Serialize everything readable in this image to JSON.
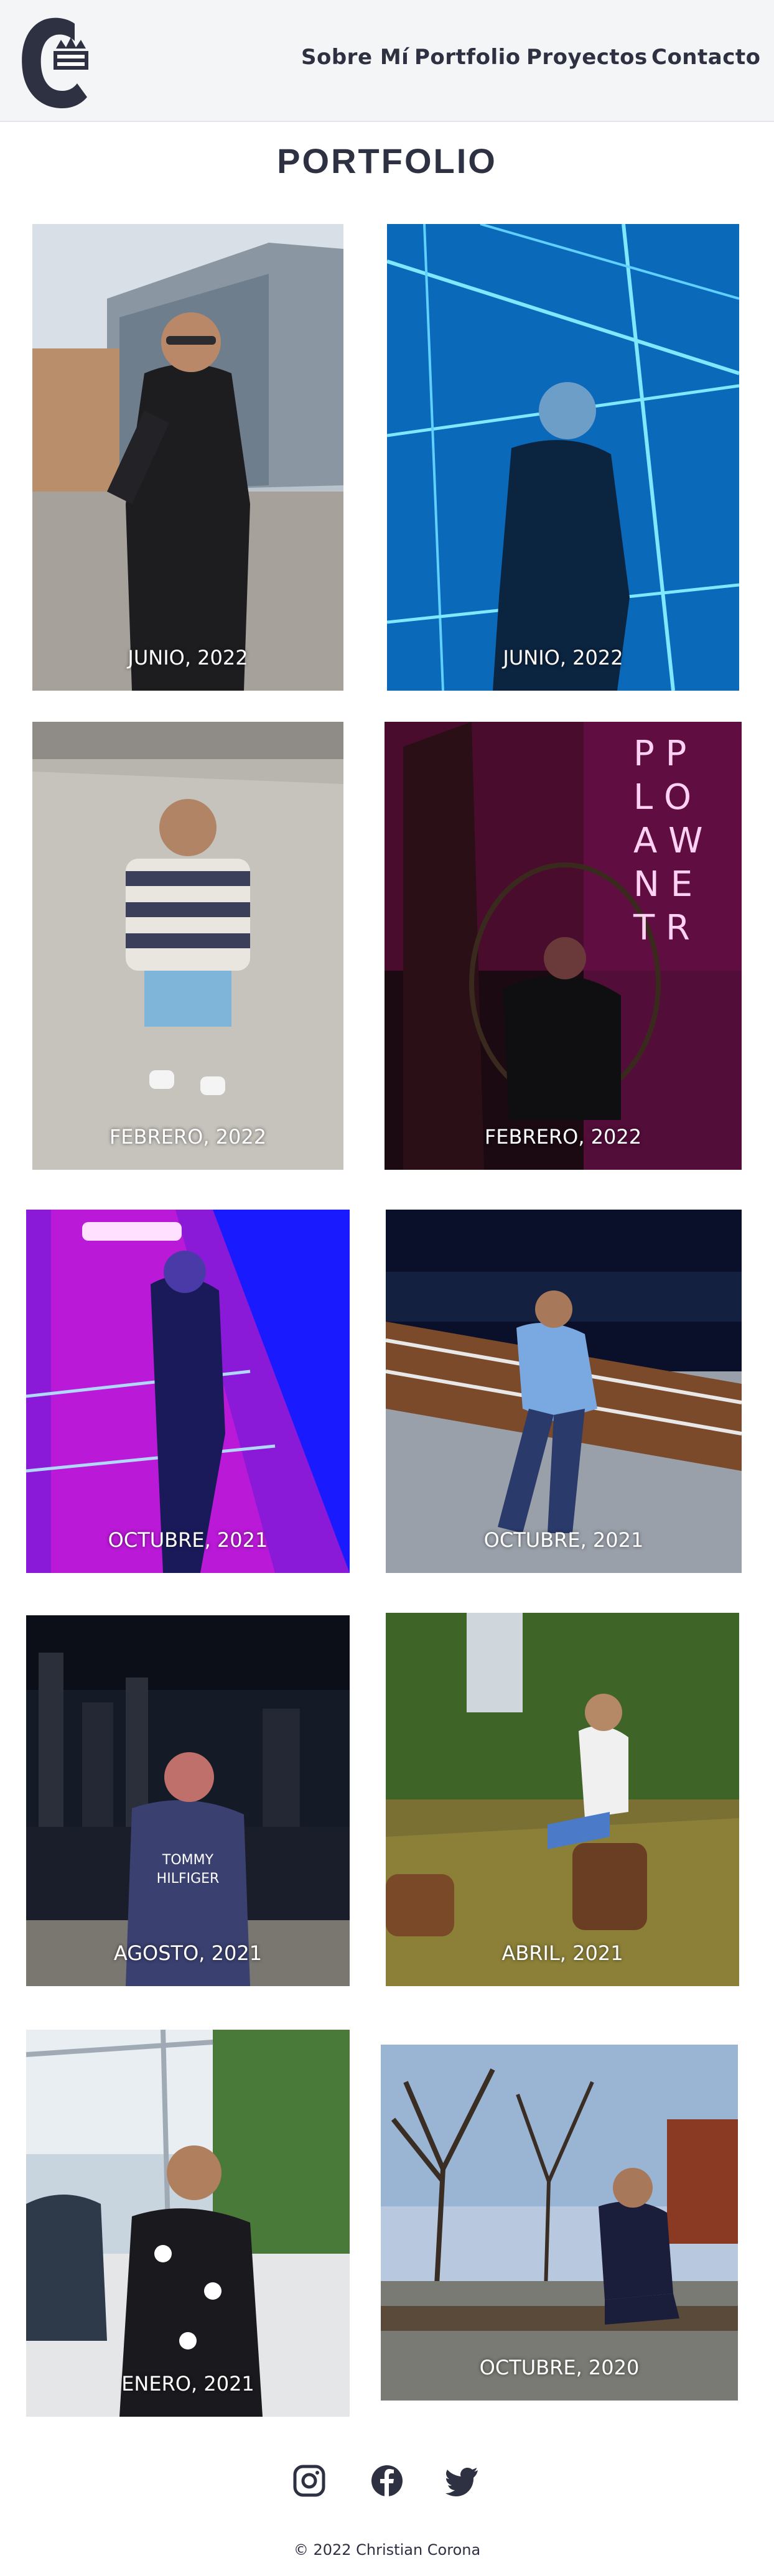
{
  "nav": {
    "items": [
      {
        "label": "Sobre Mí"
      },
      {
        "label": "Portfolio"
      },
      {
        "label": "Proyectos"
      },
      {
        "label": "Contacto"
      }
    ]
  },
  "page": {
    "title": "PORTFOLIO"
  },
  "gallery": [
    {
      "caption": "JUNIO, 2022"
    },
    {
      "caption": "JUNIO, 2022"
    },
    {
      "caption": "FEBRERO, 2022"
    },
    {
      "caption": "FEBRERO, 2022"
    },
    {
      "caption": "OCTUBRE, 2021"
    },
    {
      "caption": "OCTUBRE, 2021"
    },
    {
      "caption": "AGOSTO, 2021"
    },
    {
      "caption": "ABRIL, 2021"
    },
    {
      "caption": "ENERO, 2021"
    },
    {
      "caption": "OCTUBRE, 2020"
    }
  ],
  "social": {
    "icons": [
      "instagram-icon",
      "facebook-icon",
      "twitter-icon"
    ]
  },
  "footer": {
    "copyright": "© 2022 Christian Corona"
  },
  "colors": {
    "text": "#2d3142",
    "header_bg": "#f4f5f7",
    "caption": "#ffffff"
  }
}
